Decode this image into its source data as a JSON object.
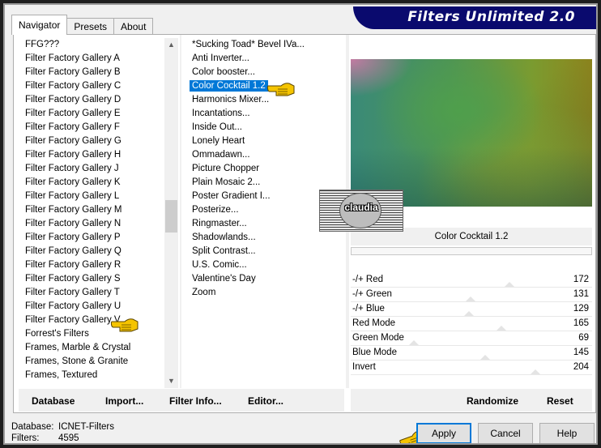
{
  "app": {
    "title": "Filters Unlimited 2.0"
  },
  "tabs": [
    {
      "label": "Navigator"
    },
    {
      "label": "Presets"
    },
    {
      "label": "About"
    }
  ],
  "categories": [
    "FFG???",
    "Filter Factory Gallery A",
    "Filter Factory Gallery B",
    "Filter Factory Gallery C",
    "Filter Factory Gallery D",
    "Filter Factory Gallery E",
    "Filter Factory Gallery F",
    "Filter Factory Gallery G",
    "Filter Factory Gallery H",
    "Filter Factory Gallery J",
    "Filter Factory Gallery K",
    "Filter Factory Gallery L",
    "Filter Factory Gallery M",
    "Filter Factory Gallery N",
    "Filter Factory Gallery P",
    "Filter Factory Gallery Q",
    "Filter Factory Gallery R",
    "Filter Factory Gallery S",
    "Filter Factory Gallery T",
    "Filter Factory Gallery U",
    "Filter Factory Gallery V",
    "Forrest's Filters",
    "Frames, Marble & Crystal",
    "Frames, Stone & Granite",
    "Frames, Textured"
  ],
  "filters": [
    "*Sucking Toad*  Bevel IVa...",
    "Anti Inverter...",
    "Color booster...",
    "Color Cocktail 1.2",
    "Harmonics Mixer...",
    "Incantations...",
    "Inside Out...",
    "Lonely Heart",
    "Ommadawn...",
    "Picture Chopper",
    "Plain Mosaic 2...",
    "Poster Gradient I...",
    "Posterize...",
    "Ringmaster...",
    "Shadowlands...",
    "Split Contrast...",
    "U.S. Comic...",
    "Valentine's Day",
    "Zoom"
  ],
  "selected_filter_index": 3,
  "selected_filter_name": "Color Cocktail 1.2",
  "logo_text": "claudia",
  "params": [
    {
      "label": "-/+ Red",
      "value": "172"
    },
    {
      "label": "-/+ Green",
      "value": "131"
    },
    {
      "label": "-/+ Blue",
      "value": "129"
    },
    {
      "label": "Red Mode",
      "value": "165"
    },
    {
      "label": "Green Mode",
      "value": "69"
    },
    {
      "label": "Blue Mode",
      "value": "145"
    },
    {
      "label": "Invert",
      "value": "204"
    }
  ],
  "left_buttons": {
    "database": "Database",
    "import": "Import...",
    "filter_info": "Filter Info...",
    "editor": "Editor..."
  },
  "right_buttons": {
    "randomize": "Randomize",
    "reset": "Reset"
  },
  "status": {
    "database_label": "Database:",
    "database_value": "ICNET-Filters",
    "filters_label": "Filters:",
    "filters_value": "4595"
  },
  "dialog_buttons": {
    "apply": "Apply",
    "cancel": "Cancel",
    "help": "Help"
  },
  "colors": {
    "banner": "#0a0a6e",
    "selection": "#0078d7",
    "hand_yellow": "#f5c400"
  }
}
